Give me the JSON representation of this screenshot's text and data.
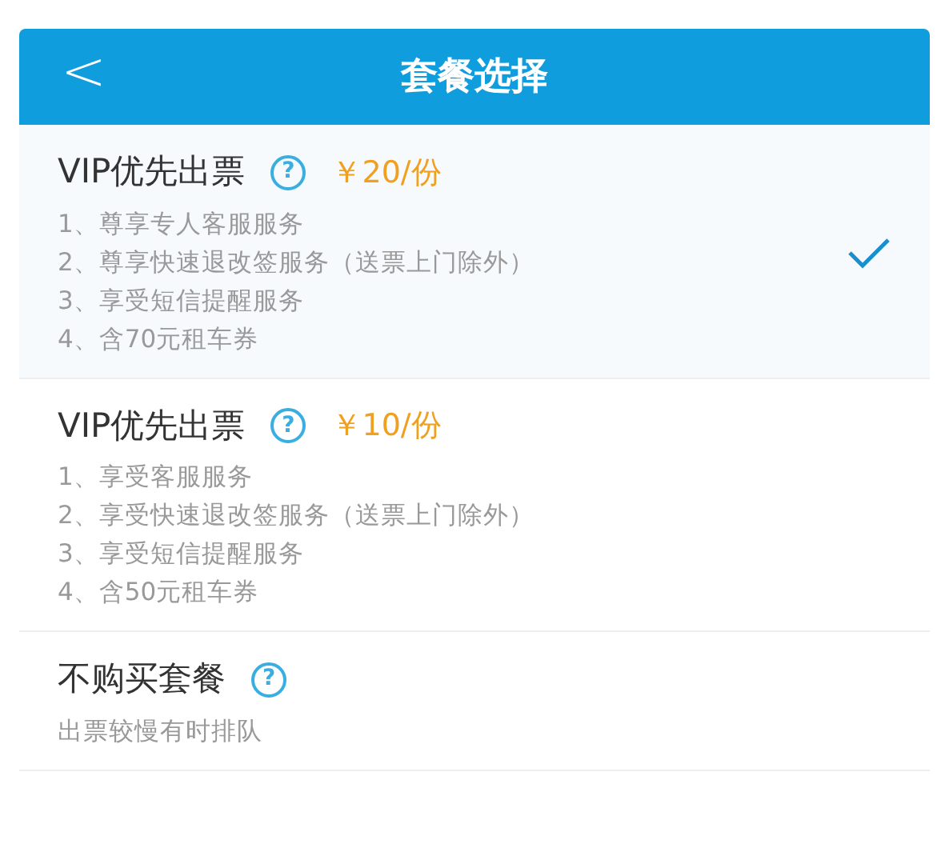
{
  "header": {
    "back": "<",
    "title": "套餐选择"
  },
  "options": [
    {
      "title": "VIP优先出票",
      "help": "?",
      "price": "￥20/份",
      "features": [
        "1、尊享专人客服服务",
        "2、尊享快速退改签服务（送票上门除外）",
        "3、享受短信提醒服务",
        "4、含70元租车券"
      ],
      "selected": true
    },
    {
      "title": "VIP优先出票",
      "help": "?",
      "price": "￥10/份",
      "features": [
        "1、享受客服服务",
        "2、享受快速退改签服务（送票上门除外）",
        "3、享受短信提醒服务",
        "4、含50元租车券"
      ],
      "selected": false
    },
    {
      "title": "不购买套餐",
      "help": "?",
      "features": [
        "出票较慢有时排队"
      ],
      "selected": false
    }
  ]
}
